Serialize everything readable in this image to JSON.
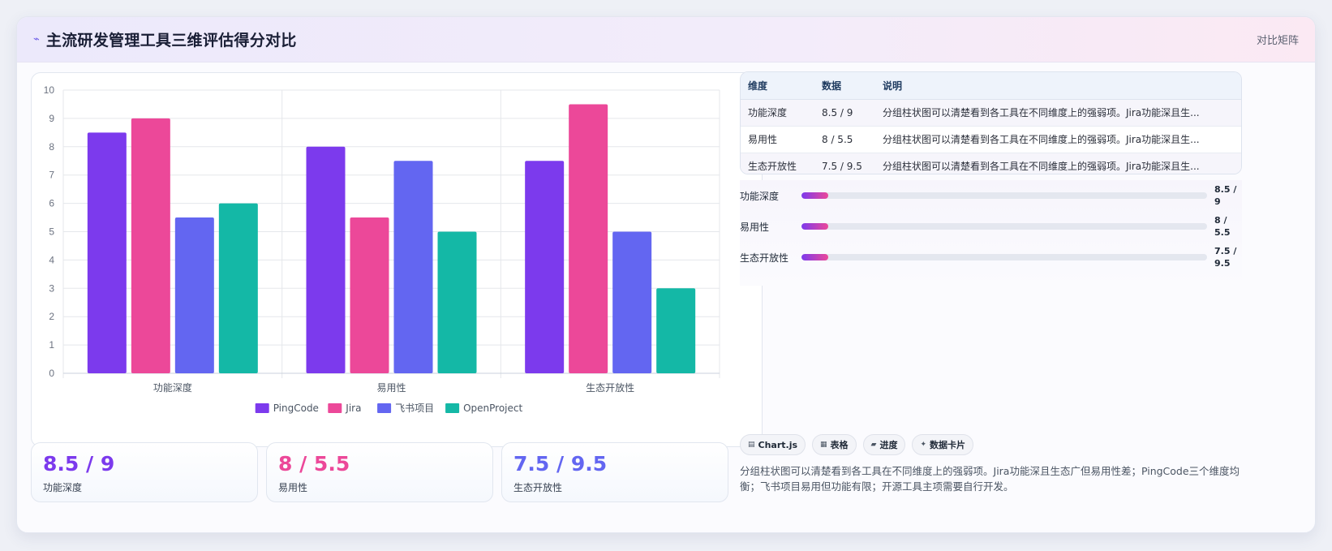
{
  "header": {
    "title": "主流研发管理工具三维评估得分对比",
    "tag": "对比矩阵"
  },
  "colors": {
    "pingcode": "#7c3aed",
    "jira": "#ec4899",
    "feishu": "#6366f1",
    "openproject": "#14b8a6"
  },
  "chart_data": {
    "type": "bar",
    "categories": [
      "功能深度",
      "易用性",
      "生态开放性"
    ],
    "ylim": [
      0,
      10
    ],
    "yticks": [
      0,
      1,
      2,
      3,
      4,
      5,
      6,
      7,
      8,
      9,
      10
    ],
    "grid": true,
    "legend_position": "bottom",
    "series": [
      {
        "name": "PingCode",
        "color": "#7c3aed",
        "values": [
          8.5,
          8,
          7.5
        ]
      },
      {
        "name": "Jira",
        "color": "#ec4899",
        "values": [
          9,
          5.5,
          9.5
        ]
      },
      {
        "name": "飞书项目",
        "color": "#6366f1",
        "values": [
          5.5,
          7.5,
          5
        ]
      },
      {
        "name": "OpenProject",
        "color": "#14b8a6",
        "values": [
          6,
          5,
          3
        ]
      }
    ]
  },
  "stats": [
    {
      "value": "8.5 / 9",
      "label": "功能深度",
      "color": "#7c3aed"
    },
    {
      "value": "8 / 5.5",
      "label": "易用性",
      "color": "#ec4899"
    },
    {
      "value": "7.5 / 9.5",
      "label": "生态开放性",
      "color": "#6366f1"
    }
  ],
  "table": {
    "headers": [
      "维度",
      "数据",
      "说明"
    ],
    "rows": [
      [
        "功能深度",
        "8.5 / 9",
        "分组柱状图可以清楚看到各工具在不同维度上的强弱项。Jira功能深且生..."
      ],
      [
        "易用性",
        "8 / 5.5",
        "分组柱状图可以清楚看到各工具在不同维度上的强弱项。Jira功能深且生..."
      ],
      [
        "生态开放性",
        "7.5 / 9.5",
        "分组柱状图可以清楚看到各工具在不同维度上的强弱项。Jira功能深且生..."
      ]
    ]
  },
  "progress": [
    {
      "label": "功能深度",
      "value_text": "8.5 / 9",
      "fill_fraction": 0.065
    },
    {
      "label": "易用性",
      "value_text": "8 / 5.5",
      "fill_fraction": 0.065
    },
    {
      "label": "生态开放性",
      "value_text": "7.5 / 9.5",
      "fill_fraction": 0.065
    }
  ],
  "chips": [
    {
      "icon": "▤",
      "label": "Chart.js"
    },
    {
      "icon": "▦",
      "label": "表格"
    },
    {
      "icon": "▰",
      "label": "进度"
    },
    {
      "icon": "✦",
      "label": "数据卡片"
    }
  ],
  "summary": "分组柱状图可以清楚看到各工具在不同维度上的强弱项。Jira功能深且生态广但易用性差；PingCode三个维度均衡；飞书项目易用但功能有限；开源工具主项需要自行开发。"
}
